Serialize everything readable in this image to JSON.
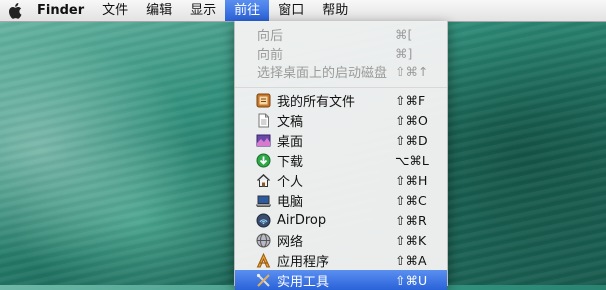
{
  "menubar": {
    "apple_icon": "apple-icon",
    "items": [
      "Finder",
      "文件",
      "编辑",
      "显示",
      "前往",
      "窗口",
      "帮助"
    ],
    "active_index": 4
  },
  "go_menu": {
    "disabled_items": [
      {
        "label": "向后",
        "shortcut": "⌘["
      },
      {
        "label": "向前",
        "shortcut": "⌘]"
      },
      {
        "label": "选择桌面上的启动磁盘",
        "shortcut": "⇧⌘↑"
      }
    ],
    "items": [
      {
        "label": "我的所有文件",
        "shortcut": "⇧⌘F",
        "icon": "all-files-icon"
      },
      {
        "label": "文稿",
        "shortcut": "⇧⌘O",
        "icon": "document-icon"
      },
      {
        "label": "桌面",
        "shortcut": "⇧⌘D",
        "icon": "desktop-icon"
      },
      {
        "label": "下载",
        "shortcut": "⌥⌘L",
        "icon": "download-icon"
      },
      {
        "label": "个人",
        "shortcut": "⇧⌘H",
        "icon": "home-icon"
      },
      {
        "label": "电脑",
        "shortcut": "⇧⌘C",
        "icon": "computer-icon"
      },
      {
        "label": "AirDrop",
        "shortcut": "⇧⌘R",
        "icon": "airdrop-icon"
      },
      {
        "label": "网络",
        "shortcut": "⇧⌘K",
        "icon": "network-icon"
      },
      {
        "label": "应用程序",
        "shortcut": "⇧⌘A",
        "icon": "applications-icon"
      },
      {
        "label": "实用工具",
        "shortcut": "⇧⌘U",
        "icon": "utilities-icon",
        "selected": true
      }
    ]
  },
  "colors": {
    "highlight": "#2f6ce0",
    "desktop": "#2f8f7a"
  }
}
